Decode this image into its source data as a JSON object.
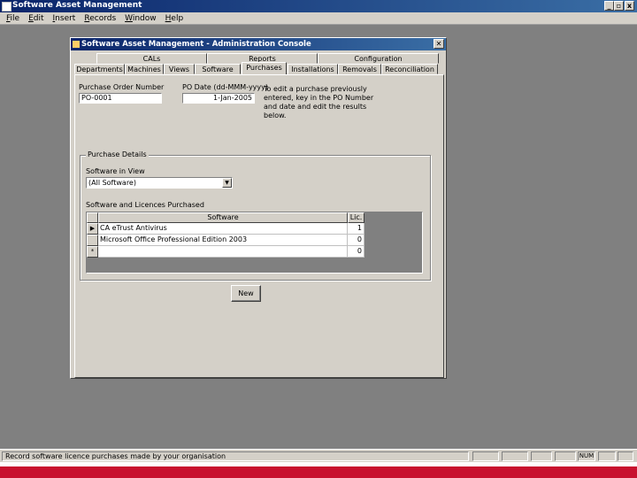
{
  "app": {
    "title": "Software Asset Management",
    "menu": [
      "File",
      "Edit",
      "Insert",
      "Records",
      "Window",
      "Help"
    ],
    "caption_buttons": {
      "minimize": "_",
      "restore": "▫",
      "close": "x"
    }
  },
  "dialog": {
    "title": "Software Asset Management - Administration Console",
    "close": "✕",
    "tabs_back": [
      "CALs",
      "Reports",
      "Configuration"
    ],
    "tabs_front": [
      "Departments",
      "Machines",
      "Views",
      "Software",
      "Purchases",
      "Installations",
      "Removals",
      "Reconciliation"
    ],
    "active_tab": "Purchases"
  },
  "form": {
    "po_label": "Purchase Order Number",
    "po_value": "PO-0001",
    "date_label": "PO Date (dd-MMM-yyyy)",
    "date_value": "1-Jan-2005",
    "info": "To edit a purchase previously entered, key in the PO Number and date and edit the results below.",
    "group_title": "Purchase Details",
    "view_label": "Software in View",
    "view_value": "(All Software)",
    "grid_label": "Software and Licences Purchased",
    "grid": {
      "columns": [
        "Software",
        "Lic."
      ],
      "rows": [
        {
          "selector": "▶",
          "software": "CA eTrust Antivirus",
          "lic": "1"
        },
        {
          "selector": "",
          "software": "Microsoft Office Professional Edition 2003",
          "lic": "0"
        },
        {
          "selector": "*",
          "software": "",
          "lic": "0"
        }
      ]
    },
    "new_button": "New"
  },
  "status": {
    "text": "Record software licence purchases made by your organisation",
    "indicator": "NUM"
  }
}
